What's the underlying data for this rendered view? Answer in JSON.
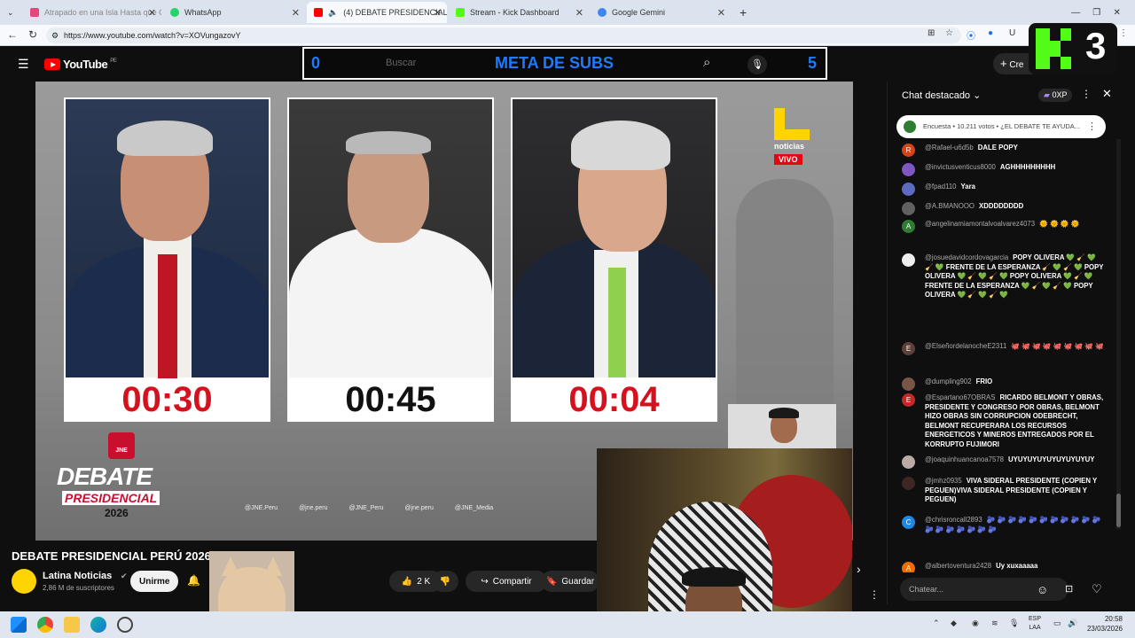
{
  "browser": {
    "tabs": [
      {
        "label": "Atrapado en una Isla Hasta que Co",
        "color": "#e8457a"
      },
      {
        "label": "WhatsApp",
        "color": "#25d366"
      },
      {
        "label": "(4) DEBATE PRESIDENCIAL PER",
        "color": "#ff0000"
      },
      {
        "label": "Stream - Kick Dashboard",
        "color": "#53fc18"
      },
      {
        "label": "Google Gemini",
        "color": "#4285f4"
      }
    ],
    "url": "https://www.youtube.com/watch?v=XOVungazovY"
  },
  "youtube": {
    "logo_text": "YouTube",
    "logo_region": "PE",
    "search_placeholder": "Buscar",
    "create_label": "Cre"
  },
  "meta_overlay": {
    "left": "0",
    "title": "META DE SUBS",
    "right": "5"
  },
  "kick_overlay": {
    "number": "3"
  },
  "video": {
    "timers": [
      {
        "value": "00:30",
        "color": "#d4121e"
      },
      {
        "value": "00:45",
        "color": "#111111"
      },
      {
        "value": "00:04",
        "color": "#d4121e"
      }
    ],
    "channel_logo_text": "noticias",
    "live_badge": "VIVO",
    "jne_label": "JNE",
    "debate_word": "DEBATE",
    "presidencial_word": "PRESIDENCIAL",
    "year": "2026",
    "socials": [
      "@JNE.Peru",
      "@jne.peru",
      "@JNE_Peru",
      "@jne.peru",
      "@JNE_Media"
    ]
  },
  "video_info": {
    "title": "DEBATE PRESIDENCIAL PERÚ 2026 -",
    "channel": "Latina Noticias",
    "subscribers": "2,86 M de suscriptores",
    "join_label": "Unirme",
    "likes": "2 K",
    "share_label": "Compartir",
    "save_label": "Guardar"
  },
  "chat": {
    "header": "Chat destacado",
    "points": "0XP",
    "poll": "Encuesta • 10.211 votos • ¿EL DEBATE TE AYUDA...",
    "input_placeholder": "Chatear...",
    "messages": [
      {
        "user": "@Rafael-u6d5b",
        "text": "DALE POPY",
        "avatar": "R",
        "color": "#d84315"
      },
      {
        "user": "@invictusventicus8000",
        "text": "AGHHHHHHHHH",
        "avatar": "",
        "color": "#7e57c2"
      },
      {
        "user": "@fpad110",
        "text": "Yara",
        "avatar": "",
        "color": "#5c6bc0"
      },
      {
        "user": "@A.BMANOOO",
        "text": "XDDDDDDDD",
        "avatar": "",
        "color": "#616161"
      },
      {
        "user": "@angelinamiamontalvoalvarez4073",
        "text": "🌞 🌞 🌞 🌞",
        "avatar": "A",
        "color": "#2e7d32"
      },
      {
        "user": "@josuedavidcordovagarcia",
        "text": "POPY OLIVERA 💚 🧹 💚 🧹 💚 FRENTE DE LA ESPERANZA 🧹 💚 🧹 💚 POPY OLIVERA 💚 🧹 💚 🧹 💚 POPY OLIVERA 💚 🧹 💚 FRENTE DE LA ESPERANZA 💚 🧹 💚 🧹 💚 POPY OLIVERA 💚 🧹 💚 🧹 💚",
        "avatar": "",
        "color": "#eeeeee"
      },
      {
        "user": "@ElseñordelanocheE2311",
        "text": "🐙 🐙 🐙 🐙 🐙 🐙 🐙 🐙 🐙",
        "avatar": "E",
        "color": "#5d4037"
      },
      {
        "user": "@dumpling902",
        "text": "FRIO",
        "avatar": "",
        "color": "#795548"
      },
      {
        "user": "@Espartano67OBRAS",
        "text": "RICARDO BELMONT Y OBRAS, PRESIDENTE Y CONGRESO POR OBRAS, BELMONT HIZO OBRAS SIN CORRUPCION ODEBRECHT, BELMONT RECUPERARA LOS RECURSOS ENERGETICOS Y MINEROS ENTREGADOS POR EL KORRUPTO FUJIMORI",
        "avatar": "E",
        "color": "#c62828"
      },
      {
        "user": "@joaquinhuancanoa7578",
        "text": "UYUYUYUYUYUYUYUYUY",
        "avatar": "",
        "color": "#bcaaa4"
      },
      {
        "user": "@jmhz0935",
        "text": "VIVA SIDERAL PRESIDENTE (COPIEN Y PEGUEN)VIVA SIDERAL PRESIDENTE (COPIEN Y PEGUEN)",
        "avatar": "",
        "color": "#3e2723"
      },
      {
        "user": "@chrisroncall2893",
        "text": "🫐 🫐 🫐 🫐 🫐 🫐 🫐 🫐 🫐 🫐 🫐 🫐 🫐 🫐 🫐 🫐 🫐 🫐",
        "avatar": "C",
        "color": "#1e88e5"
      },
      {
        "user": "@albertoventura2428",
        "text": "Uy xuxaaaaa",
        "avatar": "A",
        "color": "#ef6c00"
      }
    ]
  },
  "taskbar": {
    "lang_top": "ESP",
    "lang_bottom": "LAA",
    "time": "20:58",
    "date": "23/03/2026"
  }
}
